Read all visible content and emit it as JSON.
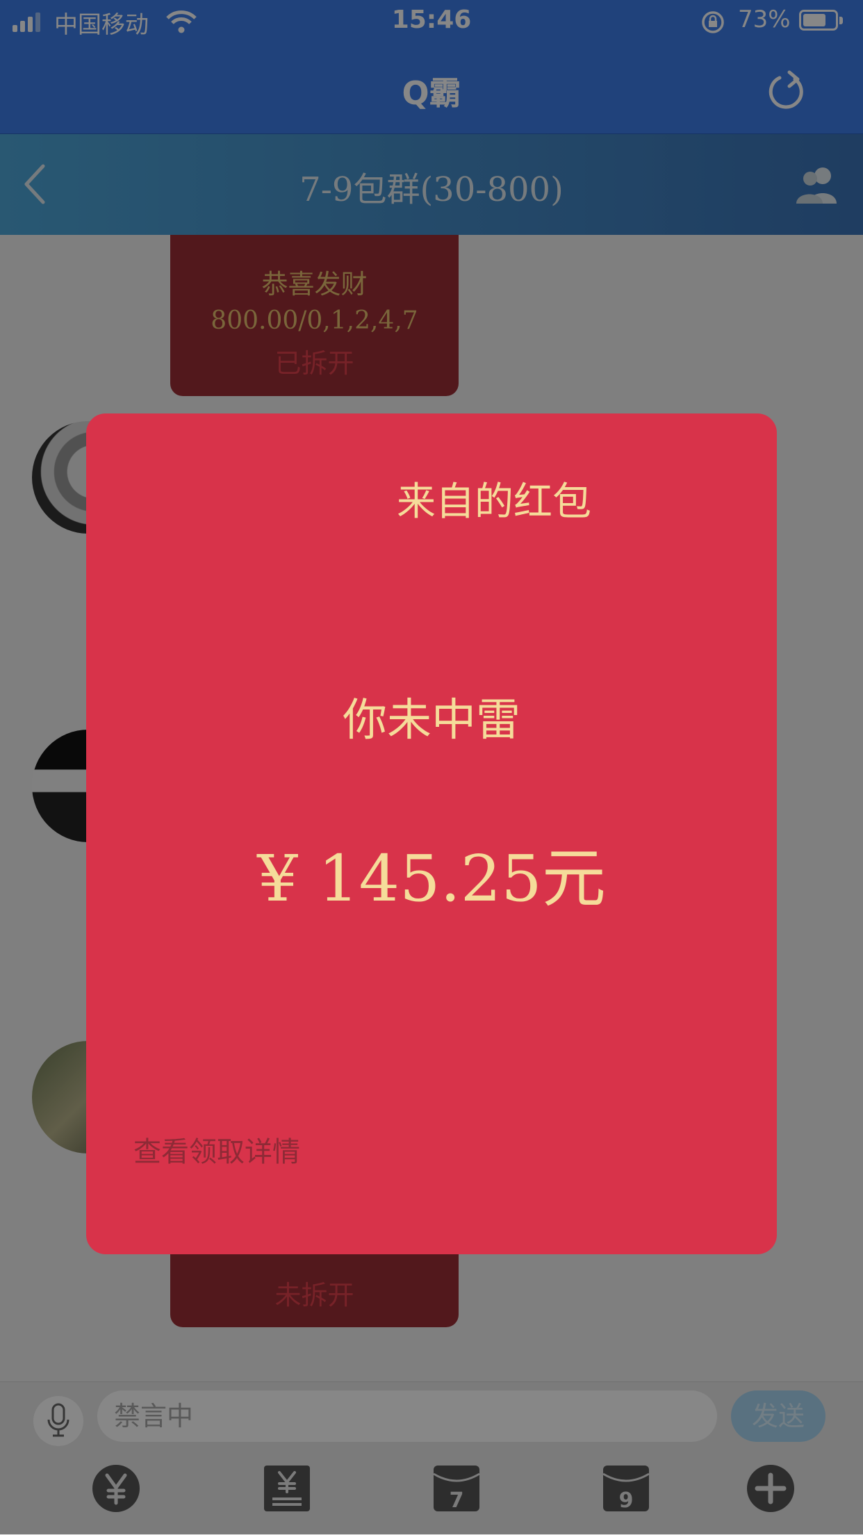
{
  "status_bar": {
    "carrier": "中国移动",
    "time": "15:46",
    "battery": "73%"
  },
  "app": {
    "title": "Q霸"
  },
  "chat": {
    "title": "7-9包群(30-800)"
  },
  "messages": [
    {
      "greeting": "恭喜发财",
      "info": "800.00/0,1,2,4,7",
      "status": "已拆开"
    },
    {
      "greeting": "",
      "info": "",
      "status": "未拆开"
    }
  ],
  "input": {
    "placeholder": "禁言中",
    "send_label": "发送"
  },
  "toolbar": {
    "icons": [
      "yuan-icon",
      "list-yuan-icon",
      "packet-7-icon",
      "packet-9-icon",
      "plus-icon"
    ],
    "packet7_number": "7",
    "packet9_number": "9"
  },
  "packet": {
    "from_suffix": "来自的红包",
    "result": "你未中雷",
    "amount": "¥ 145.25元",
    "detail_link": "查看领取详情"
  },
  "colors": {
    "header_blue": "#3d7ee8",
    "packet_red": "#d8334a",
    "packet_gold": "#f5dc9a"
  }
}
